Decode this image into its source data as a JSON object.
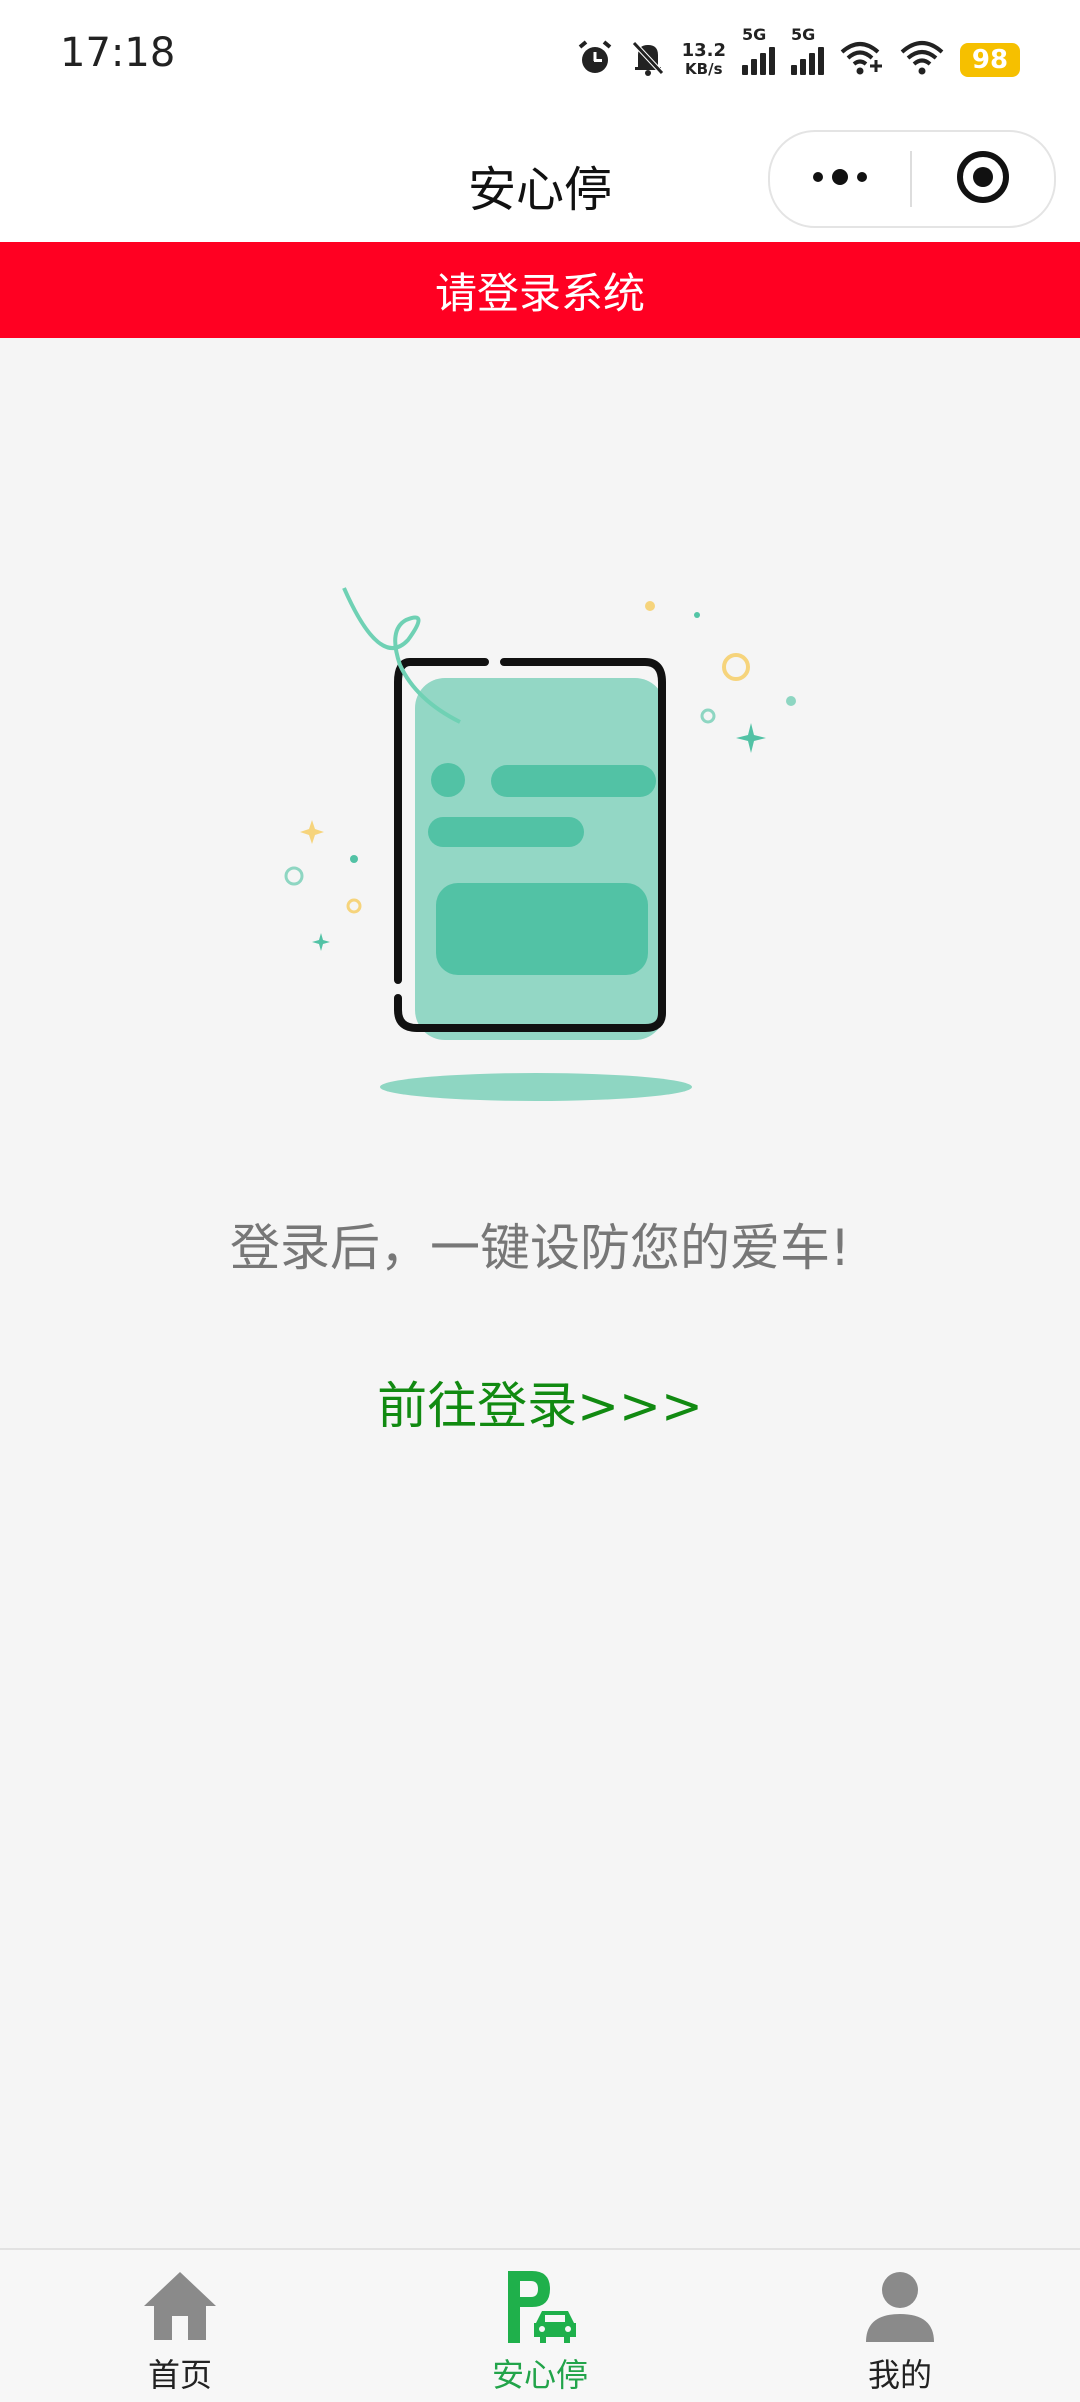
{
  "status_bar": {
    "time": "17:18",
    "speed_value": "13.2",
    "speed_unit": "KB/s",
    "sim1": "5G",
    "sim2": "5G",
    "battery": "98"
  },
  "header": {
    "title": "安心停"
  },
  "banner": {
    "text": "请登录系统"
  },
  "main": {
    "message": "登录后，一键设防您的爱车!",
    "login_link": "前往登录>>>"
  },
  "tab_bar": {
    "items": [
      {
        "label": "首页",
        "icon": "home-icon"
      },
      {
        "label": "安心停",
        "icon": "parking-car-icon",
        "active": true
      },
      {
        "label": "我的",
        "icon": "user-icon"
      }
    ]
  },
  "colors": {
    "banner": "#ff0022",
    "accent": "#22a44a",
    "link": "#118a11",
    "illustration_teal": "#4fc3a6"
  }
}
